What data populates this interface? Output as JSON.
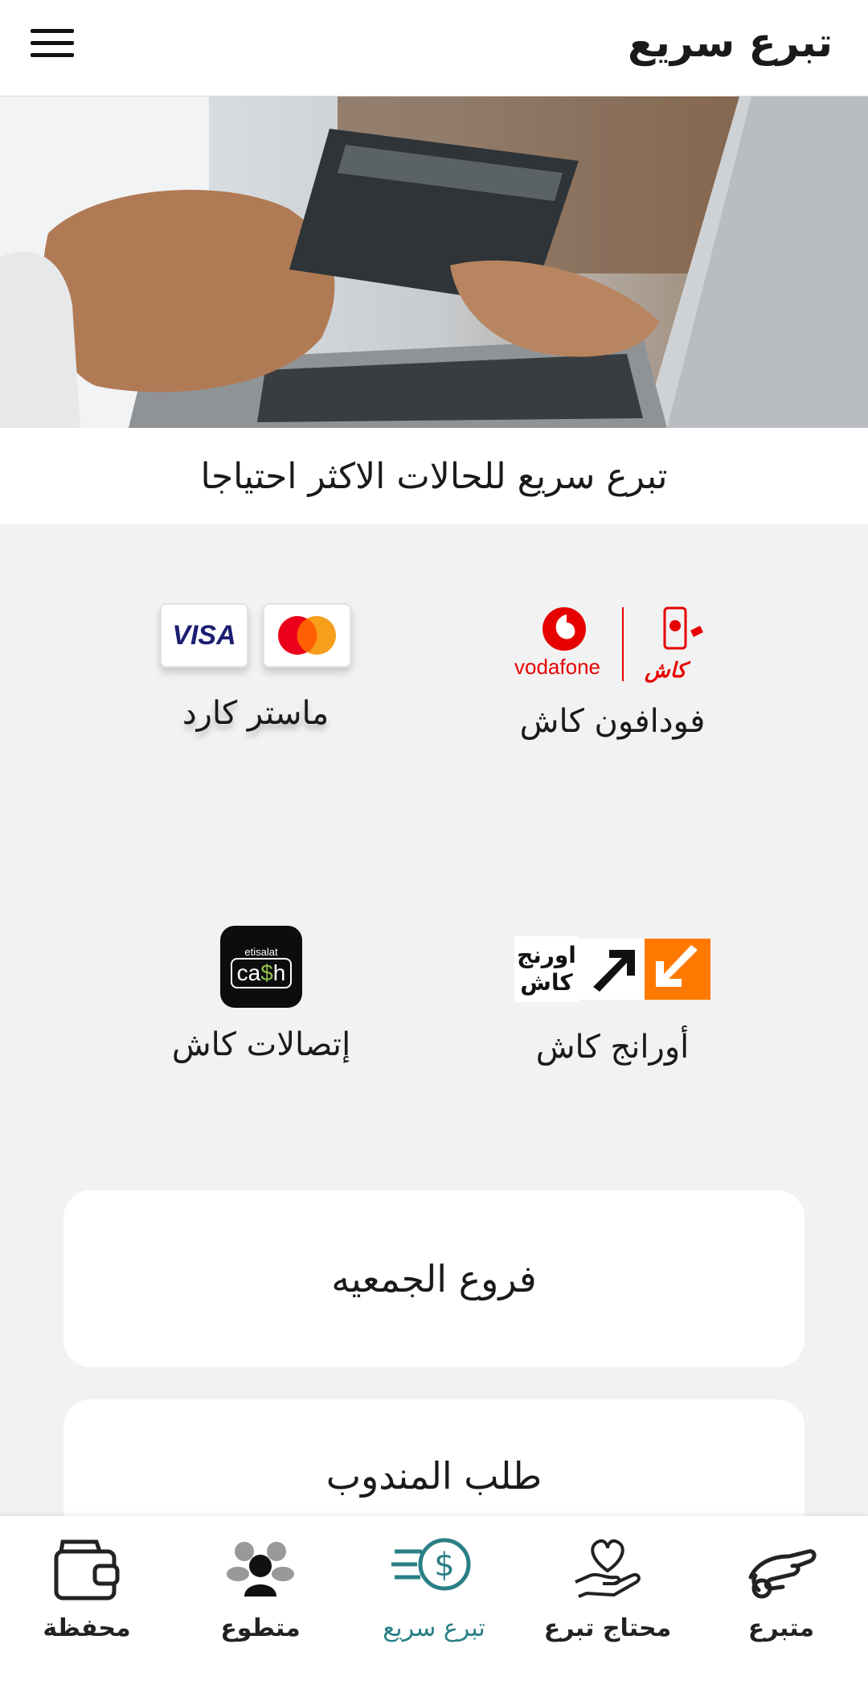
{
  "header": {
    "title": "تبرع سريع",
    "menu_icon": "hamburger-menu-icon"
  },
  "hero": {
    "image": "hand-holding-credit-card-laptop"
  },
  "tagline": "تبرع سريع للحالات الاكثر احتياجا",
  "payment_methods": [
    {
      "id": "vodafone",
      "label": "فودافون كاش",
      "logo_text": "vodafone",
      "logo_ar": "كاش",
      "color": "#e60000"
    },
    {
      "id": "mastercard",
      "label": "ماستر كارد",
      "visa_text": "VISA"
    },
    {
      "id": "orange",
      "label": "أورانج كاش",
      "logo_ar_line1": "اورنج",
      "logo_ar_line2": "كاش",
      "color": "#ff7900"
    },
    {
      "id": "etisalat",
      "label": "إتصالات كاش",
      "logo_top": "etisalat",
      "logo_main_a": "ca",
      "logo_main_dollar": "$",
      "logo_main_b": "h"
    }
  ],
  "buttons": {
    "branches": "فروع الجمعيه",
    "delegate": "طلب المندوب"
  },
  "accent_color": "#2a7f86",
  "bottom_nav": [
    {
      "label": "متبرع",
      "icon": "donor-hand-icon",
      "active": false
    },
    {
      "label": "محتاج تبرع",
      "icon": "heart-hand-icon",
      "active": false
    },
    {
      "label": "تبرع سريع",
      "icon": "fast-money-icon",
      "active": true
    },
    {
      "label": "متطوع",
      "icon": "volunteers-group-icon",
      "active": false
    },
    {
      "label": "محفظة",
      "icon": "wallet-icon",
      "active": false
    }
  ]
}
